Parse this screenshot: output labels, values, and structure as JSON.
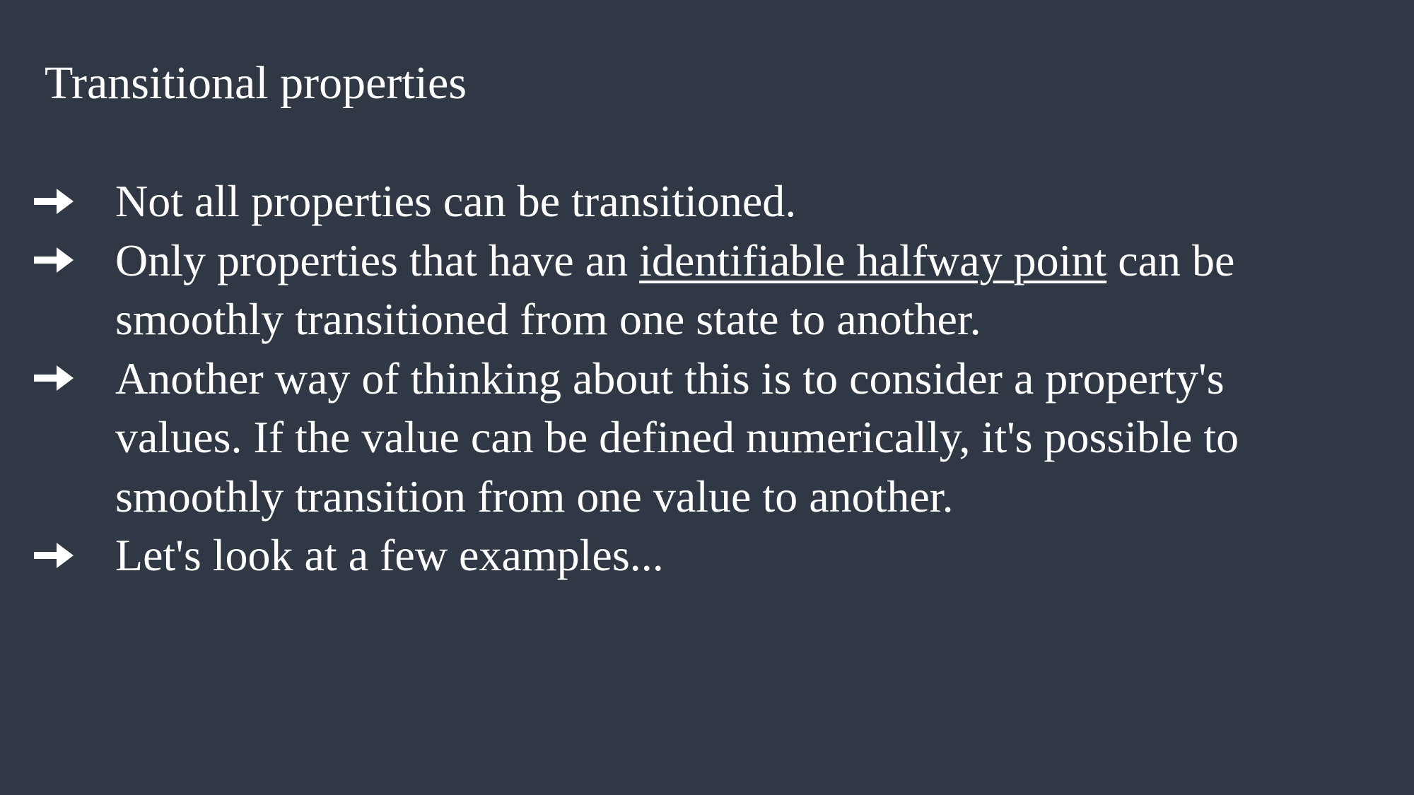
{
  "slide": {
    "title": "Transitional properties",
    "background_color": "#2f3844",
    "text_color": "#ffffff",
    "bullet_icon": "right-arrow-icon",
    "bullets": [
      {
        "text": "Not all properties can be transitioned."
      },
      {
        "before": "Only properties that have an ",
        "underlined": "identifiable halfway point",
        "after": " can be smoothly transitioned from one state to another."
      },
      {
        "text": "Another way of thinking about this is to consider a property's values. If the value can be defined numerically, it's possible to smoothly transition from one value to another."
      },
      {
        "text": "Let's look at a few examples..."
      }
    ]
  }
}
